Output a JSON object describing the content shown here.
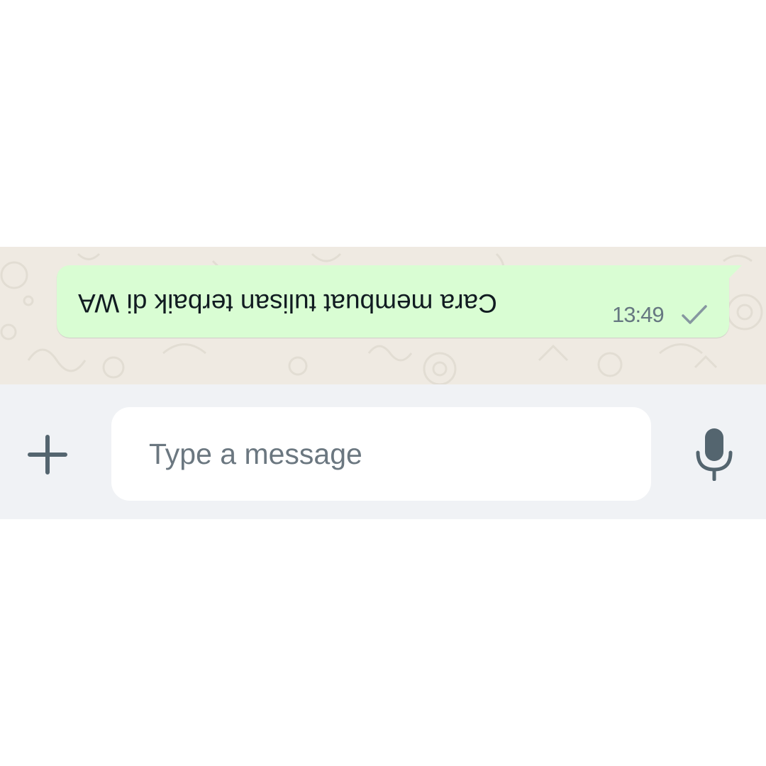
{
  "conversation": {
    "message": {
      "text": "Cara membuat tulisan terbaik di WA",
      "text_orientation": "upside-down",
      "time": "13:49",
      "status_icon": "single-check-icon",
      "bubble_color": "#d9fdd3"
    },
    "background_color": "#efeae2"
  },
  "composer": {
    "attach_icon": "plus-icon",
    "input_placeholder": "Type a message",
    "input_value": "",
    "voice_icon": "microphone-icon",
    "background_color": "#f0f2f5"
  }
}
